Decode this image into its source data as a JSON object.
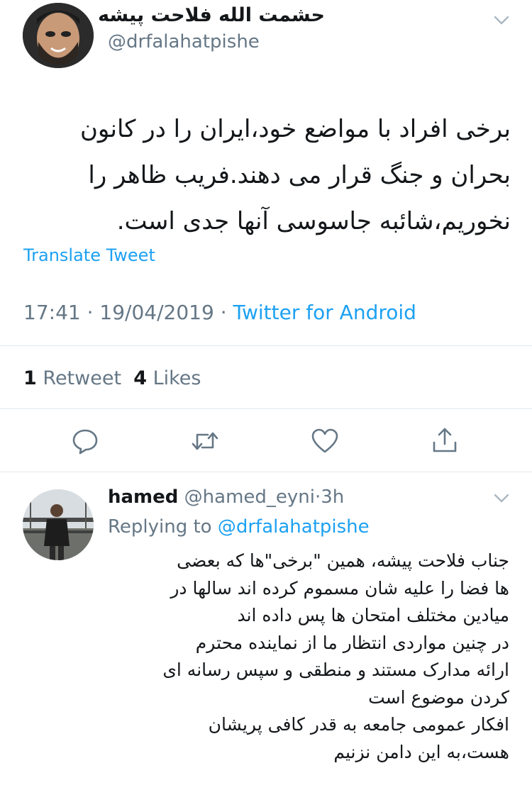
{
  "tweet": {
    "display_name": "حشمت الله فلاحت پیشه",
    "handle": "@drfalahatpishe",
    "body_lines": [
      "برخی افراد با مواضع خود،ایران را در کانون",
      "بحران و جنگ قرار می دهند.فریب ظاهر را",
      "نخوریم،شائبه جاسوسی آنها جدی است."
    ],
    "translate_label": "Translate Tweet",
    "time": "17:41",
    "date": "19/04/2019",
    "separator": "·",
    "client": "Twitter for Android",
    "retweet_count": "1",
    "retweet_label": "Retweet",
    "like_count": "4",
    "like_label": "Likes"
  },
  "icons": {
    "caret": "chevron-down-icon",
    "reply": "reply-icon",
    "retweet": "retweet-icon",
    "like": "heart-icon",
    "share": "share-icon"
  },
  "reply": {
    "name": "hamed",
    "handle": "@hamed_eyni",
    "separator": "·",
    "age": "3h",
    "replying_prefix": "Replying to",
    "replying_to": "@drfalahatpishe",
    "body_lines": [
      "جناب فلاحت پیشه، همین \"برخی\"ها که بعضی",
      "ها فضا را علیه شان مسموم کرده اند سالها در",
      "میادین مختلف امتحان ها پس داده اند",
      "در چنین مواردی انتظار ما از نماینده محترم",
      "ارائه مدارک مستند و منطقی و سپس رسانه ای",
      "کردن موضوع است",
      "افکار عمومی جامعه به قدر کافی پریشان",
      "هست،به این دامن نزنیم"
    ]
  },
  "colors": {
    "link": "#1da1f2",
    "muted": "#657786",
    "text": "#14171a",
    "divider": "#e1e8ed"
  }
}
